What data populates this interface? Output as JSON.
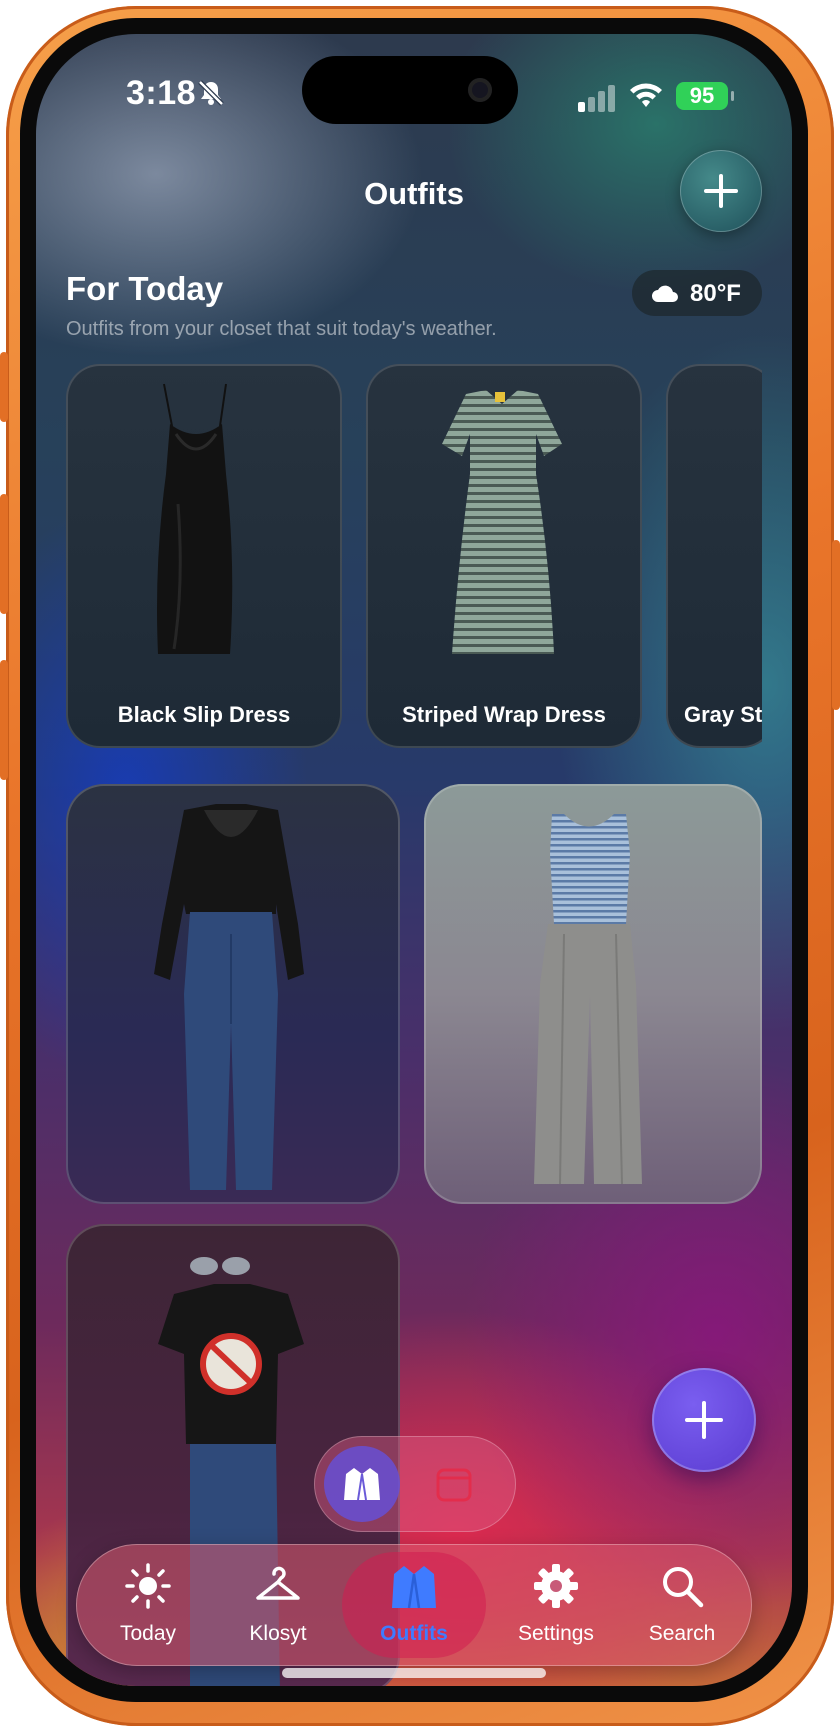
{
  "status_bar": {
    "time": "3:18",
    "battery": "95",
    "icons": [
      "bell-slash-icon",
      "cellular-signal-icon",
      "wifi-icon",
      "battery-charging-icon"
    ]
  },
  "nav": {
    "title": "Outfits",
    "add_icon": "plus-icon"
  },
  "for_today": {
    "title": "For Today",
    "subtitle": "Outfits from your closet that suit today's weather.",
    "weather": {
      "icon": "cloud-icon",
      "temp": "80°F"
    },
    "items": [
      {
        "label": "Black Slip Dress"
      },
      {
        "label": "Striped Wrap Dress"
      },
      {
        "label": "Gray St"
      }
    ]
  },
  "outfits": [
    {
      "name": "black-blouse-jeans-outfit"
    },
    {
      "name": "striped-tank-gray-trousers-outfit"
    },
    {
      "name": "ghostbusters-tee-sunglasses-outfit"
    }
  ],
  "fab": {
    "icon": "plus-icon"
  },
  "view_toggle": {
    "options": [
      "blazer-icon",
      "calendar-icon"
    ],
    "selected": "blazer-icon"
  },
  "tab_bar": {
    "tabs": [
      {
        "label": "Today",
        "icon": "sun-icon"
      },
      {
        "label": "Klosyt",
        "icon": "hanger-icon"
      },
      {
        "label": "Outfits",
        "icon": "blazer-icon"
      },
      {
        "label": "Settings",
        "icon": "gear-icon"
      },
      {
        "label": "Search",
        "icon": "search-icon"
      }
    ],
    "active": "Outfits",
    "active_color": "#3f7bff"
  },
  "colors": {
    "frame": "#e9752a",
    "fab": "#6a4ce0",
    "battery": "#30d158"
  }
}
